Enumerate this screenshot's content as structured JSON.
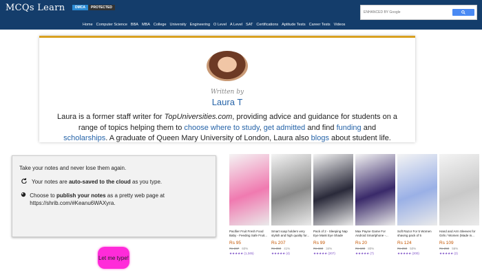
{
  "header": {
    "logo": "MCQs Learn",
    "dmca_left": "DMCA",
    "dmca_right": "PROTECTED",
    "search_placeholder": "ENHANCED BY Google",
    "nav": [
      "Home",
      "Computer Science",
      "BBA",
      "MBA",
      "College",
      "University",
      "Engineering",
      "O Level",
      "A Level",
      "SAT",
      "Certifications",
      "Aptitude Tests",
      "Career Tests",
      "Videos"
    ]
  },
  "author": {
    "written_by": "Written by",
    "name": "Laura T",
    "bio": {
      "p1": "Laura is a former staff writer for ",
      "site": "TopUniversities.com",
      "p2": ", providing advice and guidance for students on a range of topics helping them to ",
      "link1": "choose where to study",
      "p3": ", ",
      "link2": "get admitted",
      "p4": " and find ",
      "link3": "funding",
      "p5": " and ",
      "link4": "scholarships",
      "p6": ". A graduate of Queen Mary University of London, Laura also ",
      "link5": "blogs",
      "p7": " about student life."
    }
  },
  "notes": {
    "heading": "Take your notes and never lose them again.",
    "line1_pre": "Your notes are ",
    "line1_bold": "auto-saved to the cloud",
    "line1_post": " as you type.",
    "line2_pre": "Choose to ",
    "line2_bold": "publish your notes",
    "line2_post": " as a pretty web page at https://shrib.com/#Keanu6WAXyra.",
    "button": "Let me type!"
  },
  "products": [
    {
      "title": "Pacifier Fruit Fresh Food Baby - Feeding Safe Fruit...",
      "price": "Rs 95",
      "old": "Rs 237",
      "off": "60%",
      "reviews": "(1,345)",
      "color": "#f07ab0"
    },
    {
      "title": "Smart soap holders very stylish and high quality for...",
      "price": "Rs 207",
      "old": "Rs 350",
      "off": "41%",
      "reviews": "(4)",
      "color": "#8a8a8a"
    },
    {
      "title": "Pack of 2 - Sleeping Nap Eye Mask Eye Shade Cover...",
      "price": "Rs 99",
      "old": "Rs 150",
      "off": "34%",
      "reviews": "(207)",
      "color": "#2a2a3a"
    },
    {
      "title": "Max Payne Game For Android Smartphone -...",
      "price": "Rs 20",
      "old": "Rs 100",
      "off": "80%",
      "reviews": "(7)",
      "color": "#3a2a6a"
    },
    {
      "title": "Soft Razor For 5 Women shaving pack of 5",
      "price": "Rs 124",
      "old": "Rs 250",
      "off": "50%",
      "reviews": "(200)",
      "color": "#9ab0e6"
    },
    {
      "title": "Hand and Arm Sleeves for Girls / Women (Made in...",
      "price": "Rs 109",
      "old": "Rs 250",
      "off": "56%",
      "reviews": "(2)",
      "color": "#c9c9c9"
    }
  ]
}
